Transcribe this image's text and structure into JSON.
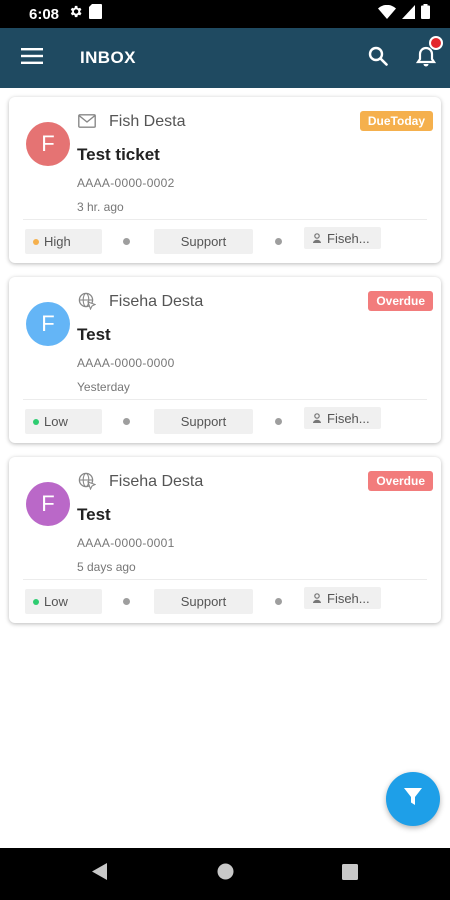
{
  "status_bar": {
    "time": "6:08"
  },
  "app_bar": {
    "title": "INBOX"
  },
  "tickets": [
    {
      "avatar_letter": "F",
      "avatar_color": "#e57373",
      "channel_icon": "mail-icon",
      "requester": "Fish Desta",
      "badge": "DueToday",
      "badge_color": "#f5b04d",
      "subject": "Test ticket",
      "ticket_id": "AAAA-0000-0002",
      "time_ago": "3 hr. ago",
      "priority": "High",
      "priority_color": "#f5b04d",
      "department": "Support",
      "agent": "Fiseh..."
    },
    {
      "avatar_letter": "F",
      "avatar_color": "#64b5f6",
      "channel_icon": "web-icon",
      "requester": "Fiseha Desta",
      "badge": "Overdue",
      "badge_color": "#f27c7c",
      "subject": "Test",
      "ticket_id": "AAAA-0000-0000",
      "time_ago": "Yesterday",
      "priority": "Low",
      "priority_color": "#2ecc71",
      "department": "Support",
      "agent": "Fiseh..."
    },
    {
      "avatar_letter": "F",
      "avatar_color": "#ba68c8",
      "channel_icon": "web-icon",
      "requester": "Fiseha Desta",
      "badge": "Overdue",
      "badge_color": "#f27c7c",
      "subject": "Test",
      "ticket_id": "AAAA-0000-0001",
      "time_ago": "5 days ago",
      "priority": "Low",
      "priority_color": "#2ecc71",
      "department": "Support",
      "agent": "Fiseh..."
    }
  ]
}
